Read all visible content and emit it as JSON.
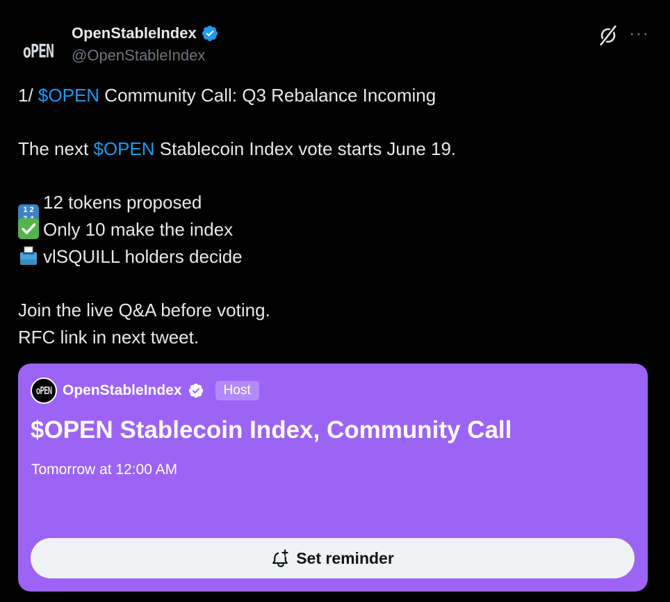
{
  "author": {
    "avatar_text": "oPEN",
    "display_name": "OpenStableIndex",
    "handle": "@OpenStableIndex",
    "verified_color": "#1d9bf0"
  },
  "header_actions": {
    "grok_icon": "grok-icon",
    "more_icon": "more-icon",
    "more_label": "···"
  },
  "tweet": {
    "line1_prefix": "1/ ",
    "line1_cashtag": "$OPEN",
    "line1_suffix": " Community Call: Q3 Rebalance Incoming",
    "line2_prefix": "The next ",
    "line2_cashtag": "$OPEN",
    "line2_suffix": " Stablecoin Index vote starts June 19.",
    "bullet1_emoji": "input-numbers-emoji",
    "bullet1_text": "12 tokens proposed",
    "bullet2_emoji": "check-mark-emoji",
    "bullet2_text": "Only 10 make the index",
    "bullet3_emoji": "ballot-box-emoji",
    "bullet3_text": "vlSQUILL holders decide",
    "line_join": "Join the live Q&A before voting.",
    "line_rfc": "RFC link in next tweet.",
    "cashtag_color": "#1d9bf0"
  },
  "space_card": {
    "background": "#9d63f6",
    "host_avatar_text": "oPEN",
    "host_name": "OpenStableIndex",
    "host_badge": "Host",
    "title": "$OPEN Stablecoin Index, Community Call",
    "time": "Tomorrow at 12:00 AM",
    "reminder_label": "Set reminder",
    "reminder_icon": "bell-plus-icon"
  }
}
